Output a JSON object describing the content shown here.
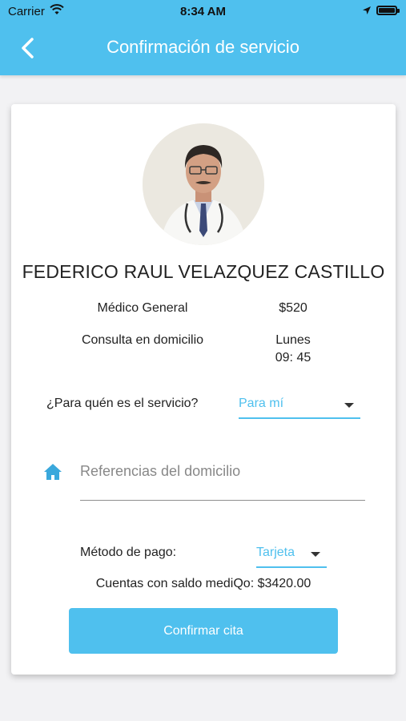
{
  "status_bar": {
    "carrier": "Carrier",
    "time": "8:34 AM",
    "icons": [
      "wifi-icon",
      "location-arrow-icon",
      "battery-icon"
    ]
  },
  "header": {
    "title": "Confirmación de servicio",
    "back_icon": "chevron-left-icon",
    "background_color": "#4fc0ee"
  },
  "doctor": {
    "name": "FEDERICO RAUL VELAZQUEZ CASTILLO",
    "specialty": "Médico General",
    "price": "$520",
    "service_type": "Consulta en domicilio",
    "day": "Lunes",
    "time": "09: 45"
  },
  "form": {
    "for_whom_label": "¿Para quén es el servicio?",
    "for_whom_value": "Para mí",
    "address_icon": "home-icon",
    "address_placeholder": "Referencias del domicilio",
    "address_value": "",
    "payment_label": "Método de pago:",
    "payment_value": "Tarjeta",
    "balance_text": "Cuentas con saldo mediQo: $3420.00"
  },
  "actions": {
    "confirm_label": "Confirmar cita"
  },
  "colors": {
    "accent": "#4fc0ee",
    "background": "#f2f2f4",
    "card": "#ffffff"
  }
}
